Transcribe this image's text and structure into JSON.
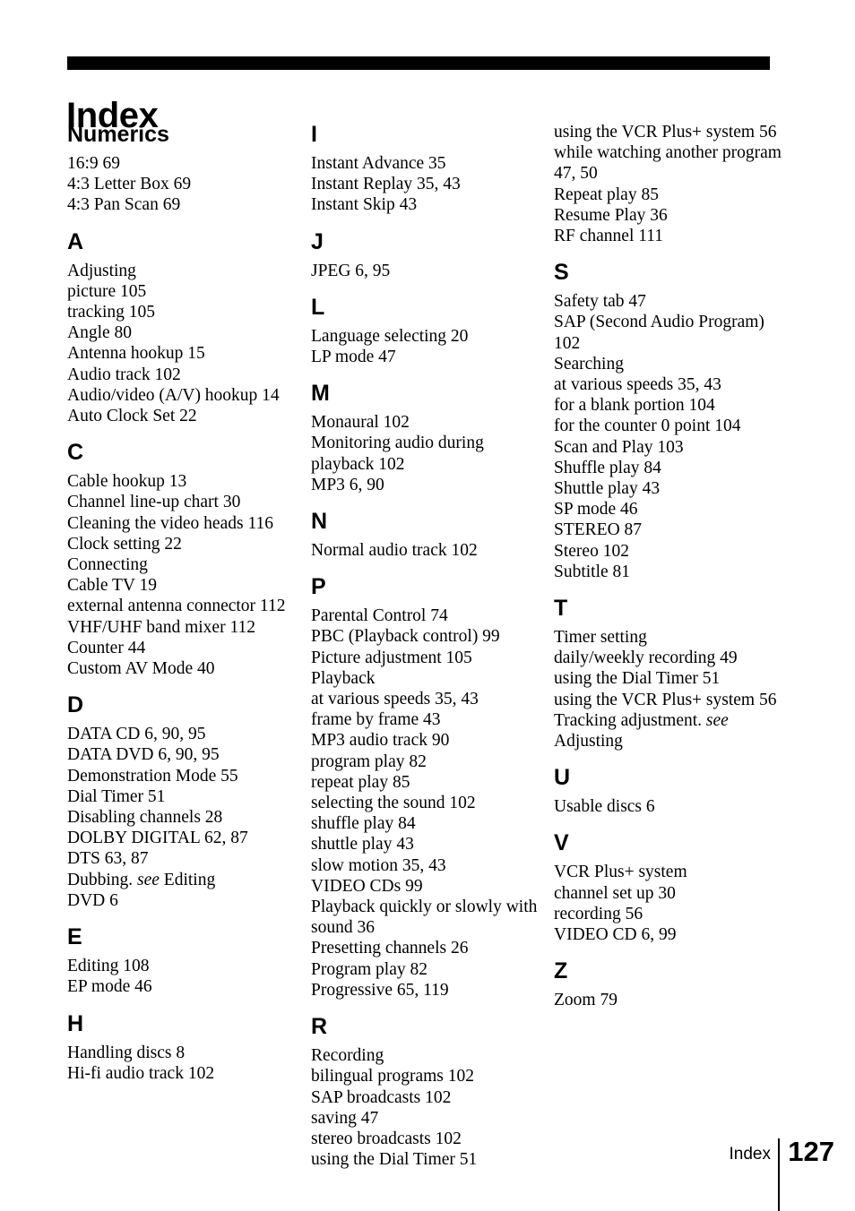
{
  "page_title": "Index",
  "footer": {
    "label": "Index",
    "page_number": "127"
  },
  "colors": {
    "text": "#000000",
    "rule": "#000000",
    "background": "#ffffff"
  },
  "columns": [
    {
      "id": "column-1",
      "groups": [
        {
          "letter": "Numerics",
          "entries": [
            {
              "level": 1,
              "text": "16:9 69"
            },
            {
              "level": 1,
              "text": "4:3 Letter Box 69"
            },
            {
              "level": 1,
              "text": "4:3 Pan Scan 69"
            }
          ]
        },
        {
          "letter": "A",
          "entries": [
            {
              "level": 1,
              "text": "Adjusting"
            },
            {
              "level": 2,
              "text": "picture 105"
            },
            {
              "level": 2,
              "text": "tracking 105"
            },
            {
              "level": 1,
              "text": "Angle 80"
            },
            {
              "level": 1,
              "text": "Antenna hookup 15"
            },
            {
              "level": 1,
              "text": "Audio track 102"
            },
            {
              "level": 1,
              "text": "Audio/video (A/V) hookup 14"
            },
            {
              "level": 1,
              "text": "Auto Clock Set 22"
            }
          ]
        },
        {
          "letter": "C",
          "entries": [
            {
              "level": 1,
              "text": "Cable hookup 13"
            },
            {
              "level": 1,
              "text": "Channel line-up chart 30"
            },
            {
              "level": 1,
              "text": "Cleaning the video heads 116"
            },
            {
              "level": 1,
              "text": "Clock setting 22"
            },
            {
              "level": 1,
              "text": "Connecting"
            },
            {
              "level": 2,
              "text": "Cable TV 19"
            },
            {
              "level": 2,
              "text": "external antenna connector 112"
            },
            {
              "level": 2,
              "text": "VHF/UHF band mixer 112"
            },
            {
              "level": 1,
              "text": "Counter 44"
            },
            {
              "level": 1,
              "text": "Custom AV Mode 40"
            }
          ]
        },
        {
          "letter": "D",
          "entries": [
            {
              "level": 1,
              "text": "DATA CD 6, 90, 95"
            },
            {
              "level": 1,
              "text": "DATA DVD 6, 90, 95"
            },
            {
              "level": 1,
              "text": "Demonstration Mode 55"
            },
            {
              "level": 1,
              "text": "Dial Timer 51"
            },
            {
              "level": 1,
              "text": "Disabling channels 28"
            },
            {
              "level": 1,
              "text": "DOLBY DIGITAL 62, 87"
            },
            {
              "level": 1,
              "text": "DTS 63, 87"
            },
            {
              "level": 1,
              "text": "Dubbing. ",
              "italic": "see",
              "text_after": " Editing"
            },
            {
              "level": 1,
              "text": "DVD 6"
            }
          ]
        },
        {
          "letter": "E",
          "entries": [
            {
              "level": 1,
              "text": "Editing 108"
            },
            {
              "level": 1,
              "text": "EP mode 46"
            }
          ]
        },
        {
          "letter": "H",
          "entries": [
            {
              "level": 1,
              "text": "Handling discs 8"
            },
            {
              "level": 1,
              "text": "Hi-fi audio track 102"
            }
          ]
        }
      ]
    },
    {
      "id": "column-2",
      "groups": [
        {
          "letter": "I",
          "entries": [
            {
              "level": 1,
              "text": "Instant Advance 35"
            },
            {
              "level": 1,
              "text": "Instant Replay 35, 43"
            },
            {
              "level": 1,
              "text": "Instant Skip 43"
            }
          ]
        },
        {
          "letter": "J",
          "entries": [
            {
              "level": 1,
              "text": "JPEG 6, 95"
            }
          ]
        },
        {
          "letter": "L",
          "entries": [
            {
              "level": 1,
              "text": "Language selecting 20"
            },
            {
              "level": 1,
              "text": "LP mode 47"
            }
          ]
        },
        {
          "letter": "M",
          "entries": [
            {
              "level": 1,
              "text": "Monaural 102"
            },
            {
              "level": 1,
              "text": "Monitoring audio during playback 102"
            },
            {
              "level": 1,
              "text": "MP3 6, 90"
            }
          ]
        },
        {
          "letter": "N",
          "entries": [
            {
              "level": 1,
              "text": "Normal audio track 102"
            }
          ]
        },
        {
          "letter": "P",
          "entries": [
            {
              "level": 1,
              "text": "Parental Control 74"
            },
            {
              "level": 1,
              "text": "PBC (Playback control) 99"
            },
            {
              "level": 1,
              "text": "Picture adjustment 105"
            },
            {
              "level": 1,
              "text": "Playback"
            },
            {
              "level": 2,
              "text": "at various speeds 35, 43"
            },
            {
              "level": 2,
              "text": "frame by frame 43"
            },
            {
              "level": 2,
              "text": "MP3 audio track 90"
            },
            {
              "level": 2,
              "text": "program play 82"
            },
            {
              "level": 2,
              "text": "repeat play 85"
            },
            {
              "level": 2,
              "text": "selecting the sound 102"
            },
            {
              "level": 2,
              "text": "shuffle play 84"
            },
            {
              "level": 2,
              "text": "shuttle play 43"
            },
            {
              "level": 2,
              "text": "slow motion 35, 43"
            },
            {
              "level": 2,
              "text": "VIDEO CDs 99"
            },
            {
              "level": 1,
              "text": "Playback quickly or slowly with sound 36"
            },
            {
              "level": 1,
              "text": "Presetting channels 26"
            },
            {
              "level": 1,
              "text": "Program play 82"
            },
            {
              "level": 1,
              "text": "Progressive 65, 119"
            }
          ]
        },
        {
          "letter": "R",
          "entries": [
            {
              "level": 1,
              "text": "Recording"
            },
            {
              "level": 2,
              "text": "bilingual programs 102"
            },
            {
              "level": 2,
              "text": "SAP broadcasts 102"
            },
            {
              "level": 2,
              "text": "saving 47"
            },
            {
              "level": 2,
              "text": "stereo broadcasts 102"
            },
            {
              "level": 2,
              "text": "using the Dial Timer 51"
            }
          ]
        }
      ]
    },
    {
      "id": "column-3",
      "groups": [
        {
          "letter": "",
          "entries": [
            {
              "level": 2,
              "text": "using the VCR Plus+ system 56"
            },
            {
              "level": 2,
              "text": "while watching another program 47, 50"
            },
            {
              "level": 1,
              "text": "Repeat play 85"
            },
            {
              "level": 1,
              "text": "Resume Play 36"
            },
            {
              "level": 1,
              "text": "RF channel 111"
            }
          ]
        },
        {
          "letter": "S",
          "entries": [
            {
              "level": 1,
              "text": "Safety tab 47"
            },
            {
              "level": 1,
              "text": "SAP (Second Audio Program) 102"
            },
            {
              "level": 1,
              "text": "Searching"
            },
            {
              "level": 2,
              "text": "at various speeds 35, 43"
            },
            {
              "level": 2,
              "text": "for a blank portion 104"
            },
            {
              "level": 2,
              "text": "for the counter 0 point 104"
            },
            {
              "level": 2,
              "text": "Scan and Play 103"
            },
            {
              "level": 1,
              "text": "Shuffle play 84"
            },
            {
              "level": 1,
              "text": "Shuttle play 43"
            },
            {
              "level": 1,
              "text": "SP mode 46"
            },
            {
              "level": 1,
              "text": "STEREO 87"
            },
            {
              "level": 1,
              "text": "Stereo 102"
            },
            {
              "level": 1,
              "text": "Subtitle 81"
            }
          ]
        },
        {
          "letter": "T",
          "entries": [
            {
              "level": 1,
              "text": "Timer setting"
            },
            {
              "level": 2,
              "text": "daily/weekly recording 49"
            },
            {
              "level": 2,
              "text": "using the Dial Timer 51"
            },
            {
              "level": 2,
              "text": "using the VCR Plus+ system 56"
            },
            {
              "level": 1,
              "text": "Tracking adjustment. ",
              "italic": "see",
              "text_after": " Adjusting"
            }
          ]
        },
        {
          "letter": "U",
          "entries": [
            {
              "level": 1,
              "text": "Usable discs 6"
            }
          ]
        },
        {
          "letter": "V",
          "entries": [
            {
              "level": 1,
              "text": "VCR Plus+ system"
            },
            {
              "level": 2,
              "text": "channel set up 30"
            },
            {
              "level": 2,
              "text": "recording 56"
            },
            {
              "level": 1,
              "text": "VIDEO CD 6, 99"
            }
          ]
        },
        {
          "letter": "Z",
          "entries": [
            {
              "level": 1,
              "text": "Zoom 79"
            }
          ]
        }
      ]
    }
  ]
}
